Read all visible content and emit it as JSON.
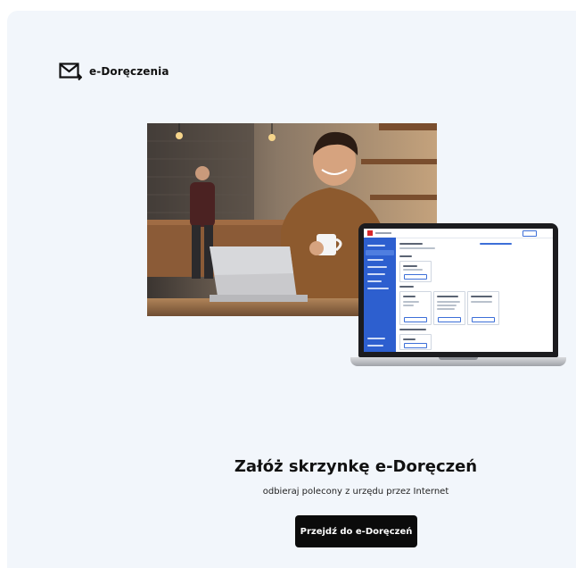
{
  "brand": {
    "name": "e-Doręczenia",
    "icon": "envelope-arrow-icon"
  },
  "hero": {
    "photo": "man-with-coffee-and-laptop-photo",
    "device": "laptop-mockup"
  },
  "headline": "Załóż skrzynkę e-Doręczeń",
  "subline": "odbieraj polecony z urzędu przez Internet",
  "cta_label": "Przejdź do e-Doręczeń",
  "colors": {
    "background": "#f2f6fb",
    "cta": "#0b0b0b",
    "cta_text": "#ffffff",
    "app_sidebar": "#2d5fcf",
    "app_logo": "#d8282b"
  }
}
